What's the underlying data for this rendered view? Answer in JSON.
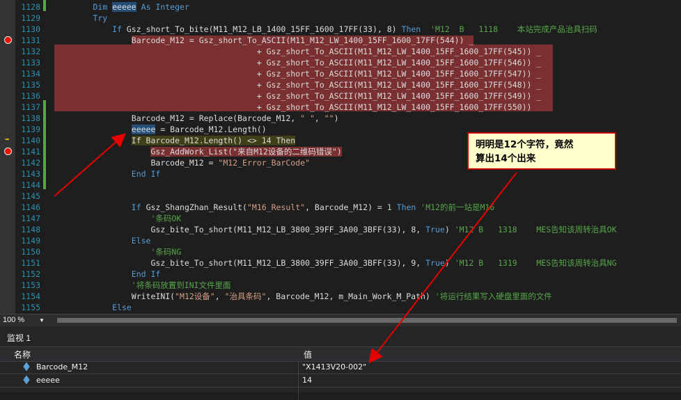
{
  "lines": [
    {
      "n": "1128",
      "segs": [
        {
          "t": "        "
        },
        {
          "t": "Dim ",
          "c": "kw"
        },
        {
          "t": "eeeee",
          "c": "selw"
        },
        {
          "t": " As Integer",
          "c": "kw"
        }
      ]
    },
    {
      "n": "1129",
      "segs": [
        {
          "t": "        "
        },
        {
          "t": "Try",
          "c": "kw"
        }
      ]
    },
    {
      "n": "1130",
      "segs": [
        {
          "t": "            "
        },
        {
          "t": "If",
          "c": "kw"
        },
        {
          "t": " Gsz_short_To_bite(M11_M12_LB_1400_15FF_1600_17FF(33), 8) "
        },
        {
          "t": "Then",
          "c": "kw"
        },
        {
          "t": "  'M12  B   1118    本站完成产品治具扫码",
          "c": "cm"
        }
      ]
    },
    {
      "n": "1131",
      "segs": [
        {
          "t": "                "
        },
        {
          "t": "Barcode_M12 = Gsz_short_To_ASCII(M11_M12_LW_1400_15FF_1600_17FF(544)) _",
          "c": "hlbg"
        }
      ]
    },
    {
      "n": "1132",
      "segs": [
        {
          "t": "                                          + Gsz_short_To_ASCII(M11_M12_LW_1400_15FF_1600_17FF(545)) _"
        }
      ]
    },
    {
      "n": "1133",
      "segs": [
        {
          "t": "                                          + Gsz_short_To_ASCII(M11_M12_LW_1400_15FF_1600_17FF(546)) _"
        }
      ]
    },
    {
      "n": "1134",
      "segs": [
        {
          "t": "                                          + Gsz_short_To_ASCII(M11_M12_LW_1400_15FF_1600_17FF(547)) _"
        }
      ]
    },
    {
      "n": "1135",
      "segs": [
        {
          "t": "                                          + Gsz_short_To_ASCII(M11_M12_LW_1400_15FF_1600_17FF(548)) _"
        }
      ]
    },
    {
      "n": "1136",
      "segs": [
        {
          "t": "                                          + Gsz_short_To_ASCII(M11_M12_LW_1400_15FF_1600_17FF(549)) _"
        }
      ]
    },
    {
      "n": "1137",
      "segs": [
        {
          "t": "                                          + Gsz_short_To_ASCII(M11_M12_LW_1400_15FF_1600_17FF(550))"
        }
      ]
    },
    {
      "n": "1138",
      "segs": [
        {
          "t": "                Barcode_M12 = Replace(Barcode_M12, "
        },
        {
          "t": "\" \"",
          "c": "str"
        },
        {
          "t": ", "
        },
        {
          "t": "\"\"",
          "c": "str"
        },
        {
          "t": ")"
        }
      ]
    },
    {
      "n": "1139",
      "segs": [
        {
          "t": "                "
        },
        {
          "t": "eeeee",
          "c": "selw"
        },
        {
          "t": " = Barcode_M12.Length()"
        }
      ]
    },
    {
      "n": "1140",
      "segs": [
        {
          "t": "                "
        },
        {
          "t": "If Barcode_M12.Length() <> 14 Then",
          "c": "cur"
        }
      ]
    },
    {
      "n": "1141",
      "segs": [
        {
          "t": "                    "
        },
        {
          "t": "Gsz_AddWork_List(\"来自M12设备的二维码错误\")",
          "c": "hlbg"
        }
      ]
    },
    {
      "n": "1142",
      "segs": [
        {
          "t": "                    Barcode_M12 = "
        },
        {
          "t": "\"M12_Error_BarCode\"",
          "c": "str"
        }
      ]
    },
    {
      "n": "1143",
      "segs": [
        {
          "t": "                "
        },
        {
          "t": "End If",
          "c": "kw"
        }
      ]
    },
    {
      "n": "1144",
      "segs": [
        {
          "t": ""
        }
      ]
    },
    {
      "n": "1145",
      "segs": [
        {
          "t": ""
        }
      ]
    },
    {
      "n": "1146",
      "segs": [
        {
          "t": "                "
        },
        {
          "t": "If",
          "c": "kw"
        },
        {
          "t": " Gsz_ShangZhan_Result("
        },
        {
          "t": "\"M16_Result\"",
          "c": "str"
        },
        {
          "t": ", Barcode_M12) = "
        },
        {
          "t": "1",
          "c": "num"
        },
        {
          "t": " "
        },
        {
          "t": "Then",
          "c": "kw"
        },
        {
          "t": " 'M12的前一站是M16",
          "c": "cm"
        }
      ]
    },
    {
      "n": "1147",
      "segs": [
        {
          "t": "                    "
        },
        {
          "t": "'条码OK",
          "c": "cm"
        }
      ]
    },
    {
      "n": "1148",
      "segs": [
        {
          "t": "                    Gsz_bite_To_short(M11_M12_LB_3800_39FF_3A00_3BFF(33), 8, "
        },
        {
          "t": "True",
          "c": "kw"
        },
        {
          "t": ") "
        },
        {
          "t": "'M12 B   1318    MES告知该周转治具OK",
          "c": "cm"
        }
      ]
    },
    {
      "n": "1149",
      "segs": [
        {
          "t": "                "
        },
        {
          "t": "Else",
          "c": "kw"
        }
      ]
    },
    {
      "n": "1150",
      "segs": [
        {
          "t": "                    "
        },
        {
          "t": "'条码NG",
          "c": "cm"
        }
      ]
    },
    {
      "n": "1151",
      "segs": [
        {
          "t": "                    Gsz_bite_To_short(M11_M12_LB_3800_39FF_3A00_3BFF(33), 9, "
        },
        {
          "t": "True",
          "c": "kw"
        },
        {
          "t": ") "
        },
        {
          "t": "'M12 B   1319    MES告知该周转治具NG",
          "c": "cm"
        }
      ]
    },
    {
      "n": "1152",
      "segs": [
        {
          "t": "                "
        },
        {
          "t": "End If",
          "c": "kw"
        }
      ]
    },
    {
      "n": "1153",
      "segs": [
        {
          "t": "                "
        },
        {
          "t": "'将条码放置到INI文件里面",
          "c": "cm"
        }
      ]
    },
    {
      "n": "1154",
      "segs": [
        {
          "t": "                WriteINI("
        },
        {
          "t": "\"M12设备\"",
          "c": "str"
        },
        {
          "t": ", "
        },
        {
          "t": "\"治具条码\"",
          "c": "str"
        },
        {
          "t": ", Barcode_M12, m_Main_Work_M_Path) "
        },
        {
          "t": "'将运行结果写入硬盘里面的文件",
          "c": "cm"
        }
      ]
    },
    {
      "n": "1155",
      "segs": [
        {
          "t": "            "
        },
        {
          "t": "Else",
          "c": "kw"
        }
      ]
    }
  ],
  "zoom": "100 %",
  "watch": {
    "title": "监视 1",
    "col_name": "名称",
    "col_value": "值",
    "rows": [
      {
        "name": "Barcode_M12",
        "value": "\"X1413V20-002\""
      },
      {
        "name": "eeeee",
        "value": "14"
      }
    ]
  },
  "annotation": {
    "line1": "明明是12个字符，竟然",
    "line2": "算出14个出来"
  },
  "colors": {
    "breakpoint": "#e51400",
    "highlight": "#7a2f31",
    "annotation_border": "#c00000",
    "arrow": "#e80000"
  },
  "icons": [
    "breakpoint-icon",
    "current-line-arrow-icon",
    "watch-variable-icon",
    "dropdown-chevron-icon"
  ]
}
